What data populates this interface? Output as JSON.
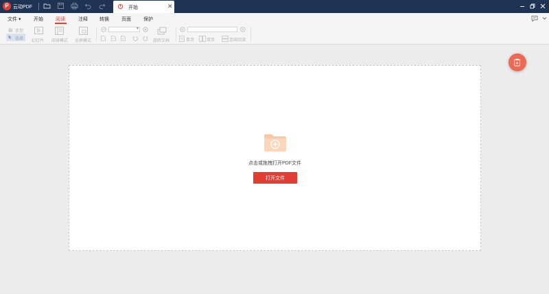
{
  "app": {
    "name": "云动PDF"
  },
  "tab": {
    "label": "开始",
    "close": "✕"
  },
  "menu": {
    "file": "文件",
    "items": [
      "开始",
      "阅读",
      "注释",
      "转换",
      "页面",
      "保护"
    ]
  },
  "toolbar": {
    "hand": "手型",
    "select": "选择",
    "slideshow": "幻灯片",
    "reading_mode": "阅读模式",
    "fullscreen": "全屏模式",
    "rotate": "旋转文档",
    "single": "单页",
    "double": "双页",
    "continuous": "连续阅读"
  },
  "main": {
    "prompt": "点击或拖拽打开PDF文件",
    "open_button": "打开文件"
  },
  "colors": {
    "titlebar": "#1f3354",
    "accent": "#e23d33",
    "folder": "#f9c8a4",
    "float": "#ea6a56"
  }
}
